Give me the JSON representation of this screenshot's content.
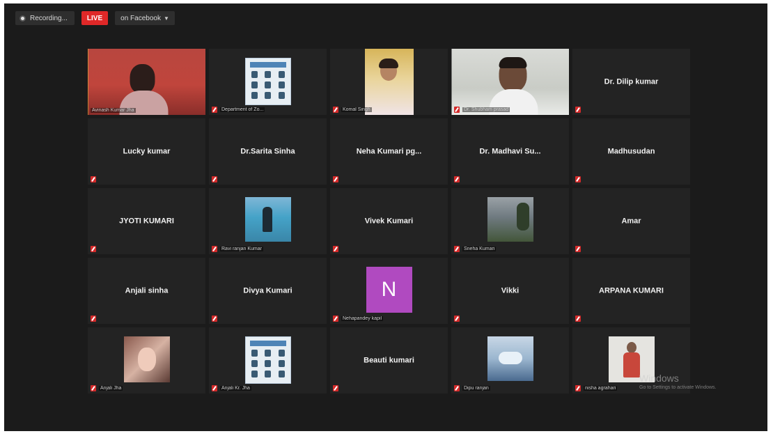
{
  "topbar": {
    "recording_label": "Recording...",
    "live_label": "LIVE",
    "live_target": "on Facebook"
  },
  "tiles": [
    {
      "name": "",
      "label": "Avinash Kumar Jha",
      "muted": false
    },
    {
      "name": "",
      "label": "Department of Zo...",
      "muted": true
    },
    {
      "name": "",
      "label": "Komal Singh",
      "muted": true
    },
    {
      "name": "",
      "label": "Dr. Shubham prasad",
      "muted": true
    },
    {
      "name": "Dr. Dilip kumar",
      "label": "",
      "muted": true
    },
    {
      "name": "Lucky kumar",
      "label": "",
      "muted": true
    },
    {
      "name": "Dr.Sarita Sinha",
      "label": "",
      "muted": true
    },
    {
      "name": "Neha Kumari pg...",
      "label": "",
      "muted": true
    },
    {
      "name": "Dr. Madhavi Su...",
      "label": "",
      "muted": true
    },
    {
      "name": "Madhusudan",
      "label": "",
      "muted": true
    },
    {
      "name": "JYOTI KUMARI",
      "label": "",
      "muted": true
    },
    {
      "name": "",
      "label": "Ravi ranjan Kumar",
      "muted": true
    },
    {
      "name": "Vivek Kumari",
      "label": "",
      "muted": true
    },
    {
      "name": "",
      "label": "Sneha Kumari",
      "muted": true
    },
    {
      "name": "Amar",
      "label": "",
      "muted": true
    },
    {
      "name": "Anjali sinha",
      "label": "",
      "muted": true
    },
    {
      "name": "Divya Kumari",
      "label": "",
      "muted": true
    },
    {
      "name": "",
      "label": "Nehapandey kapil",
      "muted": true,
      "avatar_letter": "N"
    },
    {
      "name": "Vikki",
      "label": "",
      "muted": true
    },
    {
      "name": "ARPANA KUMARI",
      "label": "",
      "muted": true
    },
    {
      "name": "",
      "label": "Anjali Jha",
      "muted": true
    },
    {
      "name": "",
      "label": "Anjali Kr. Jha",
      "muted": true
    },
    {
      "name": "Beauti kumari",
      "label": "",
      "muted": true
    },
    {
      "name": "",
      "label": "Dipu ranjan",
      "muted": true
    },
    {
      "name": "",
      "label": "nisha agrahari",
      "muted": true
    }
  ],
  "watermark": {
    "title": "Windows",
    "subtitle": "Go to Settings to activate Windows."
  }
}
